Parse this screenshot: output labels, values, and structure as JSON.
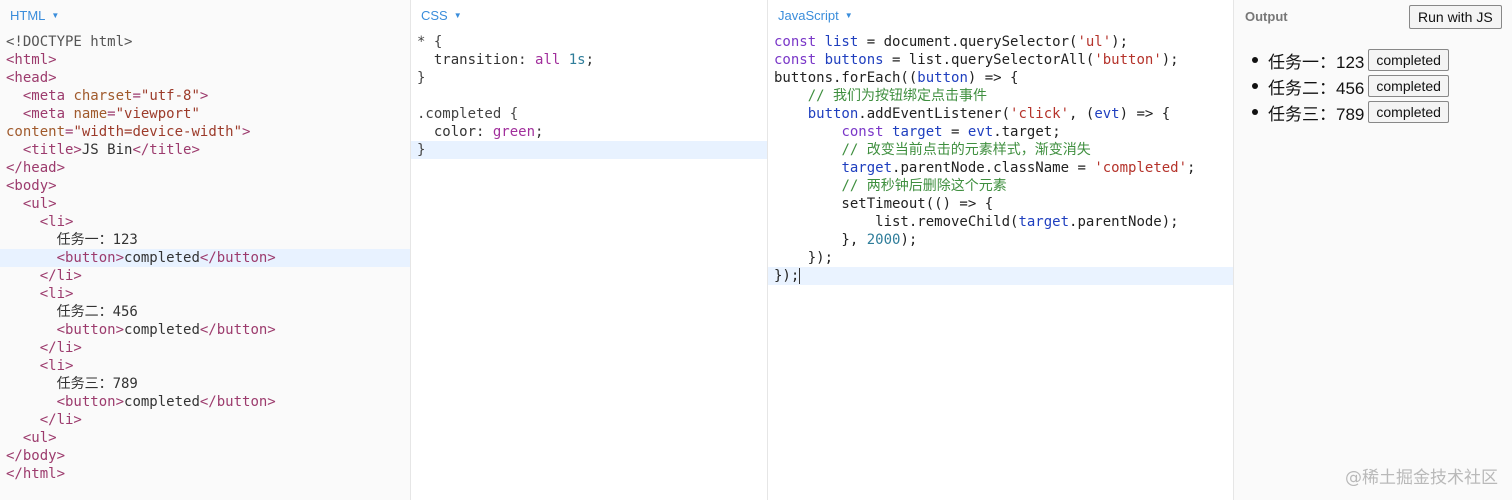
{
  "panels": {
    "html": {
      "label": "HTML"
    },
    "css": {
      "label": "CSS"
    },
    "js": {
      "label": "JavaScript"
    },
    "output": {
      "label": "Output",
      "run_label": "Run with JS"
    }
  },
  "html_code": [
    [
      [
        "doctype",
        "<!DOCTYPE html>"
      ]
    ],
    [
      [
        "tag",
        "<html>"
      ]
    ],
    [
      [
        "tag",
        "<head>"
      ]
    ],
    [
      [
        "text",
        "  "
      ],
      [
        "tag",
        "<meta "
      ],
      [
        "attr",
        "charset"
      ],
      [
        "tag",
        "="
      ],
      [
        "str",
        "\"utf-8\""
      ],
      [
        "tag",
        ">"
      ]
    ],
    [
      [
        "text",
        "  "
      ],
      [
        "tag",
        "<meta "
      ],
      [
        "attr",
        "name"
      ],
      [
        "tag",
        "="
      ],
      [
        "str",
        "\"viewport\""
      ]
    ],
    [
      [
        "attr",
        "content"
      ],
      [
        "tag",
        "="
      ],
      [
        "str",
        "\"width=device-width\""
      ],
      [
        "tag",
        ">"
      ]
    ],
    [
      [
        "text",
        "  "
      ],
      [
        "tag",
        "<title>"
      ],
      [
        "text",
        "JS Bin"
      ],
      [
        "tag",
        "</title>"
      ]
    ],
    [
      [
        "tag",
        "</head>"
      ]
    ],
    [
      [
        "tag",
        "<body>"
      ]
    ],
    [
      [
        "text",
        "  "
      ],
      [
        "tag",
        "<ul>"
      ]
    ],
    [
      [
        "text",
        "    "
      ],
      [
        "tag",
        "<li>"
      ]
    ],
    [
      [
        "text",
        "      任务一：123"
      ]
    ],
    [
      [
        "text",
        "      "
      ],
      [
        "tag",
        "<button>"
      ],
      [
        "text",
        "completed"
      ],
      [
        "tag",
        "</button>"
      ]
    ],
    [
      [
        "text",
        "    "
      ],
      [
        "tag",
        "</li>"
      ]
    ],
    [
      [
        "text",
        "    "
      ],
      [
        "tag",
        "<li>"
      ]
    ],
    [
      [
        "text",
        "      任务二：456"
      ]
    ],
    [
      [
        "text",
        "      "
      ],
      [
        "tag",
        "<button>"
      ],
      [
        "text",
        "completed"
      ],
      [
        "tag",
        "</button>"
      ]
    ],
    [
      [
        "text",
        "    "
      ],
      [
        "tag",
        "</li>"
      ]
    ],
    [
      [
        "text",
        "    "
      ],
      [
        "tag",
        "<li>"
      ]
    ],
    [
      [
        "text",
        "      任务三：789"
      ]
    ],
    [
      [
        "text",
        "      "
      ],
      [
        "tag",
        "<button>"
      ],
      [
        "text",
        "completed"
      ],
      [
        "tag",
        "</button>"
      ]
    ],
    [
      [
        "text",
        "    "
      ],
      [
        "tag",
        "</li>"
      ]
    ],
    [
      [
        "text",
        "  "
      ],
      [
        "tag",
        "<ul>"
      ]
    ],
    [
      [
        "tag",
        "</body>"
      ]
    ],
    [
      [
        "tag",
        "</html>"
      ]
    ]
  ],
  "html_active_line": 12,
  "css_code": [
    [
      [
        "css-sel",
        "* {"
      ]
    ],
    [
      [
        "css-prop",
        "  transition: "
      ],
      [
        "css-val",
        "all"
      ],
      [
        "css-prop",
        " "
      ],
      [
        "css-num",
        "1s"
      ],
      [
        "css-prop",
        ";"
      ]
    ],
    [
      [
        "css-sel",
        "}"
      ]
    ],
    [
      [
        "css-sel",
        ""
      ]
    ],
    [
      [
        "css-sel",
        ".completed {"
      ]
    ],
    [
      [
        "css-prop",
        "  color: "
      ],
      [
        "css-green",
        "green"
      ],
      [
        "css-prop",
        ";"
      ]
    ],
    [
      [
        "css-sel",
        "}"
      ]
    ]
  ],
  "css_active_line": 6,
  "js_code": [
    [
      [
        "kw",
        "const "
      ],
      [
        "var",
        "list"
      ],
      [
        "plain",
        " = document.querySelector("
      ],
      [
        "jsstr",
        "'ul'"
      ],
      [
        "plain",
        ");"
      ]
    ],
    [
      [
        "kw",
        "const "
      ],
      [
        "var",
        "buttons"
      ],
      [
        "plain",
        " = list.querySelectorAll("
      ],
      [
        "jsstr",
        "'button'"
      ],
      [
        "plain",
        ");"
      ]
    ],
    [
      [
        "plain",
        "buttons.forEach(("
      ],
      [
        "var",
        "button"
      ],
      [
        "plain",
        ") => {"
      ]
    ],
    [
      [
        "plain",
        "    "
      ],
      [
        "comment",
        "// 我们为按钮绑定点击事件"
      ]
    ],
    [
      [
        "plain",
        "    "
      ],
      [
        "var",
        "button"
      ],
      [
        "plain",
        ".addEventListener("
      ],
      [
        "jsstr",
        "'click'"
      ],
      [
        "plain",
        ", ("
      ],
      [
        "var",
        "evt"
      ],
      [
        "plain",
        ") => {"
      ]
    ],
    [
      [
        "plain",
        "        "
      ],
      [
        "kw",
        "const "
      ],
      [
        "var",
        "target"
      ],
      [
        "plain",
        " = "
      ],
      [
        "var",
        "evt"
      ],
      [
        "plain",
        ".target;"
      ]
    ],
    [
      [
        "plain",
        "        "
      ],
      [
        "comment",
        "// 改变当前点击的元素样式，渐变消失"
      ]
    ],
    [
      [
        "plain",
        "        "
      ],
      [
        "var",
        "target"
      ],
      [
        "plain",
        ".parentNode.className = "
      ],
      [
        "jsstr",
        "'completed'"
      ],
      [
        "plain",
        ";"
      ]
    ],
    [
      [
        "plain",
        "        "
      ],
      [
        "comment",
        "// 两秒钟后删除这个元素"
      ]
    ],
    [
      [
        "plain",
        "        setTimeout(() => {"
      ]
    ],
    [
      [
        "plain",
        "            list.removeChild("
      ],
      [
        "var",
        "target"
      ],
      [
        "plain",
        ".parentNode);"
      ]
    ],
    [
      [
        "plain",
        "        }, "
      ],
      [
        "num",
        "2000"
      ],
      [
        "plain",
        ");"
      ]
    ],
    [
      [
        "plain",
        "    });"
      ]
    ],
    [
      [
        "plain",
        "});"
      ]
    ]
  ],
  "js_active_line": 13,
  "output_items": [
    {
      "text": "任务一：123",
      "button": "completed"
    },
    {
      "text": "任务二：456",
      "button": "completed"
    },
    {
      "text": "任务三：789",
      "button": "completed"
    }
  ],
  "watermark": "@稀土掘金技术社区"
}
